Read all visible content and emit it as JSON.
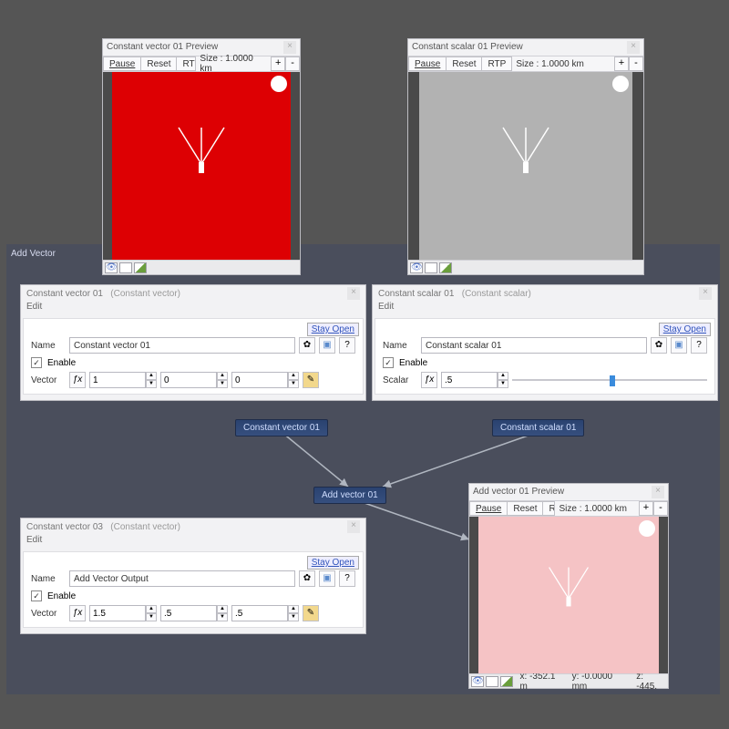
{
  "section_label": "Add Vector",
  "preview1": {
    "title": "Constant vector 01 Preview",
    "pause": "Pause",
    "reset": "Reset",
    "rtp": "RTP",
    "size": "Size : 1.0000 km"
  },
  "preview2": {
    "title": "Constant scalar 01 Preview",
    "pause": "Pause",
    "reset": "Reset",
    "rtp": "RTP",
    "size": "Size : 1.0000 km"
  },
  "preview3": {
    "title": "Add vector 01 Preview",
    "pause": "Pause",
    "reset": "Reset",
    "rtp": "R",
    "size": "Size : 1.0000 km",
    "coords": {
      "x": "x: -352.1 m",
      "y": "y: -0.0000 mm",
      "z": "z: -445."
    }
  },
  "prop1": {
    "title": "Constant vector 01",
    "type": "(Constant vector)",
    "edit": "Edit",
    "stay": "Stay Open",
    "name_label": "Name",
    "name_value": "Constant vector 01",
    "enable": "Enable",
    "vector_label": "Vector",
    "vx": "1",
    "vy": "0",
    "vz": "0"
  },
  "prop2": {
    "title": "Constant scalar 01",
    "type": "(Constant scalar)",
    "edit": "Edit",
    "stay": "Stay Open",
    "name_label": "Name",
    "name_value": "Constant scalar 01",
    "enable": "Enable",
    "scalar_label": "Scalar",
    "scalar_value": ".5"
  },
  "prop3": {
    "title": "Constant vector 03",
    "type": "(Constant vector)",
    "edit": "Edit",
    "stay": "Stay Open",
    "name_label": "Name",
    "name_value": "Add Vector Output",
    "enable": "Enable",
    "vector_label": "Vector",
    "vx": "1.5",
    "vy": ".5",
    "vz": ".5"
  },
  "nodes": {
    "n1": "Constant vector 01",
    "n2": "Constant scalar 01",
    "n3": "Add vector 01"
  },
  "glyph": {
    "gear": "✿",
    "q": "?",
    "plus": "+",
    "minus": "-",
    "check": "✓",
    "up": "▲",
    "dn": "▼",
    "fx": "ƒx"
  }
}
